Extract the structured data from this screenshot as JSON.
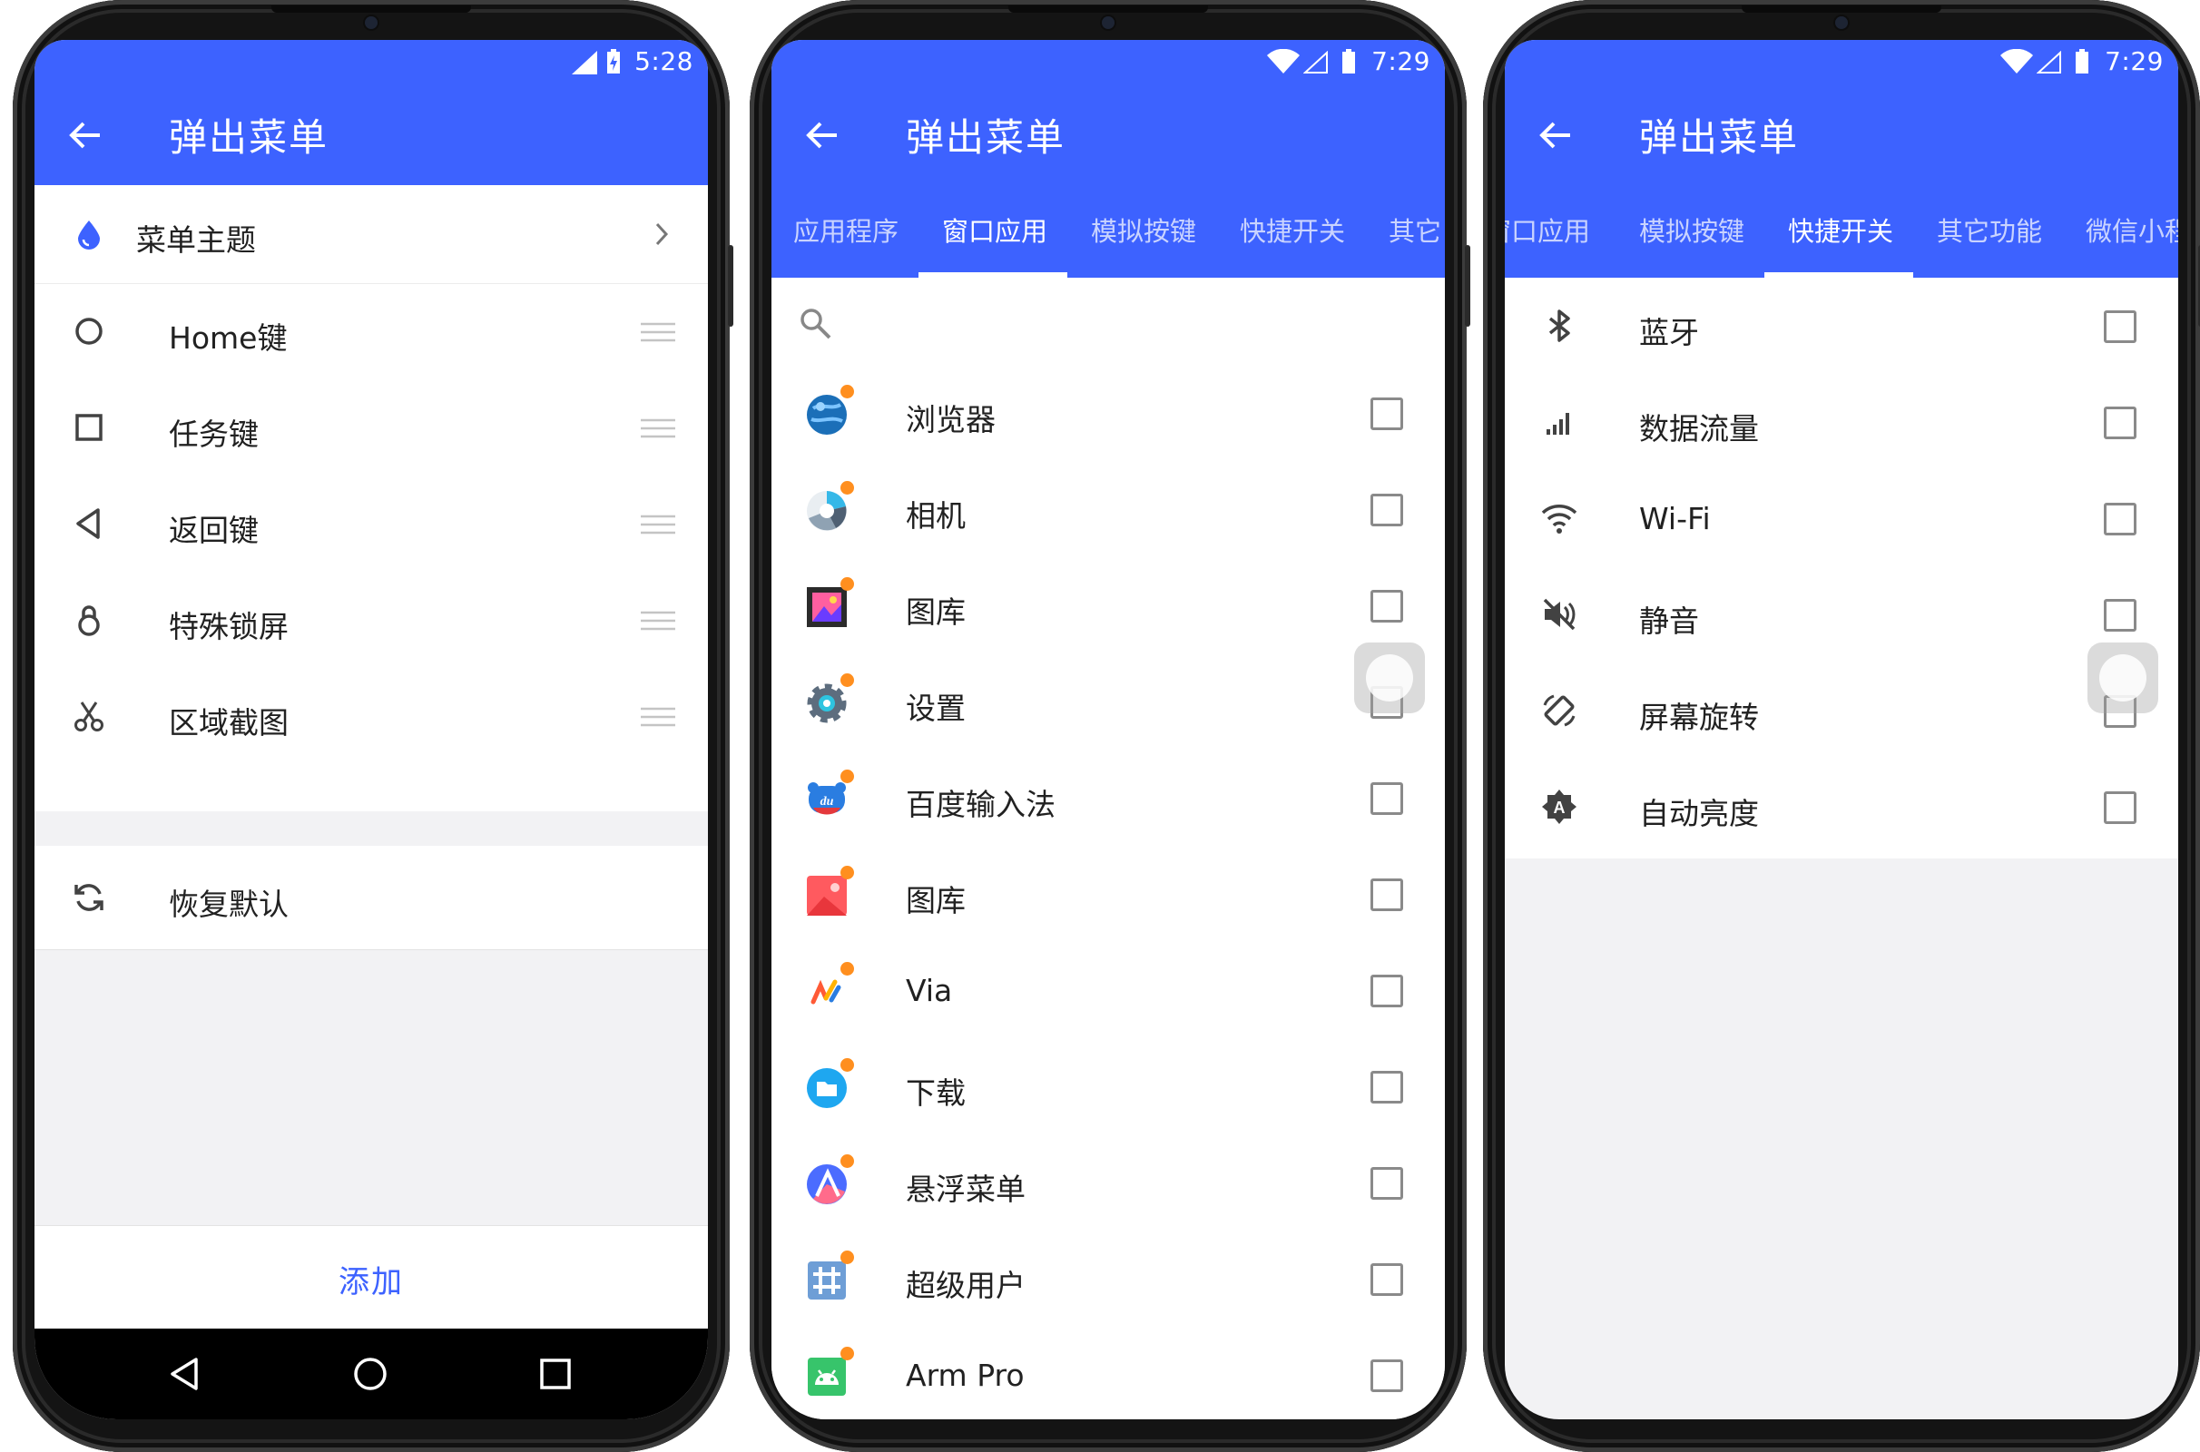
{
  "colors": {
    "primary": "#3d62ff",
    "accent_dot": "#ff8f1f",
    "text": "#212121",
    "icon": "#424242"
  },
  "phone1": {
    "status_time": "5:28",
    "title": "弹出菜单",
    "theme_row": "菜单主题",
    "items": [
      {
        "label": "Home键",
        "icon": "circle-icon"
      },
      {
        "label": "任务键",
        "icon": "square-icon"
      },
      {
        "label": "返回键",
        "icon": "triangle-back-icon"
      },
      {
        "label": "特殊锁屏",
        "icon": "lock-icon"
      },
      {
        "label": "区域截图",
        "icon": "scissors-icon"
      }
    ],
    "restore": "恢复默认",
    "add": "添加"
  },
  "phone2": {
    "status_time": "7:29",
    "title": "弹出菜单",
    "tabs": [
      "应用程序",
      "窗口应用",
      "模拟按键",
      "快捷开关",
      "其它"
    ],
    "active_tab": 1,
    "apps": [
      {
        "label": "浏览器",
        "icon": "globe-icon"
      },
      {
        "label": "相机",
        "icon": "camera-icon"
      },
      {
        "label": "图库",
        "icon": "gallery-icon"
      },
      {
        "label": "设置",
        "icon": "settings-gear-icon"
      },
      {
        "label": "百度输入法",
        "icon": "baidu-input-icon"
      },
      {
        "label": "图库",
        "icon": "gallery-red-icon"
      },
      {
        "label": "Via",
        "icon": "via-icon"
      },
      {
        "label": "下载",
        "icon": "download-folder-icon"
      },
      {
        "label": "悬浮菜单",
        "icon": "float-menu-icon"
      },
      {
        "label": "超级用户",
        "icon": "superuser-icon"
      },
      {
        "label": "Arm Pro",
        "icon": "android-icon"
      }
    ]
  },
  "phone3": {
    "status_time": "7:29",
    "title": "弹出菜单",
    "tabs": [
      "窗口应用",
      "模拟按键",
      "快捷开关",
      "其它功能",
      "微信小程"
    ],
    "active_tab": 2,
    "switches": [
      {
        "label": "蓝牙",
        "icon": "bluetooth-icon"
      },
      {
        "label": "数据流量",
        "icon": "signal-bars-icon"
      },
      {
        "label": "Wi-Fi",
        "icon": "wifi-icon"
      },
      {
        "label": "静音",
        "icon": "mute-icon"
      },
      {
        "label": "屏幕旋转",
        "icon": "rotate-icon"
      },
      {
        "label": "自动亮度",
        "icon": "auto-brightness-icon"
      }
    ]
  }
}
